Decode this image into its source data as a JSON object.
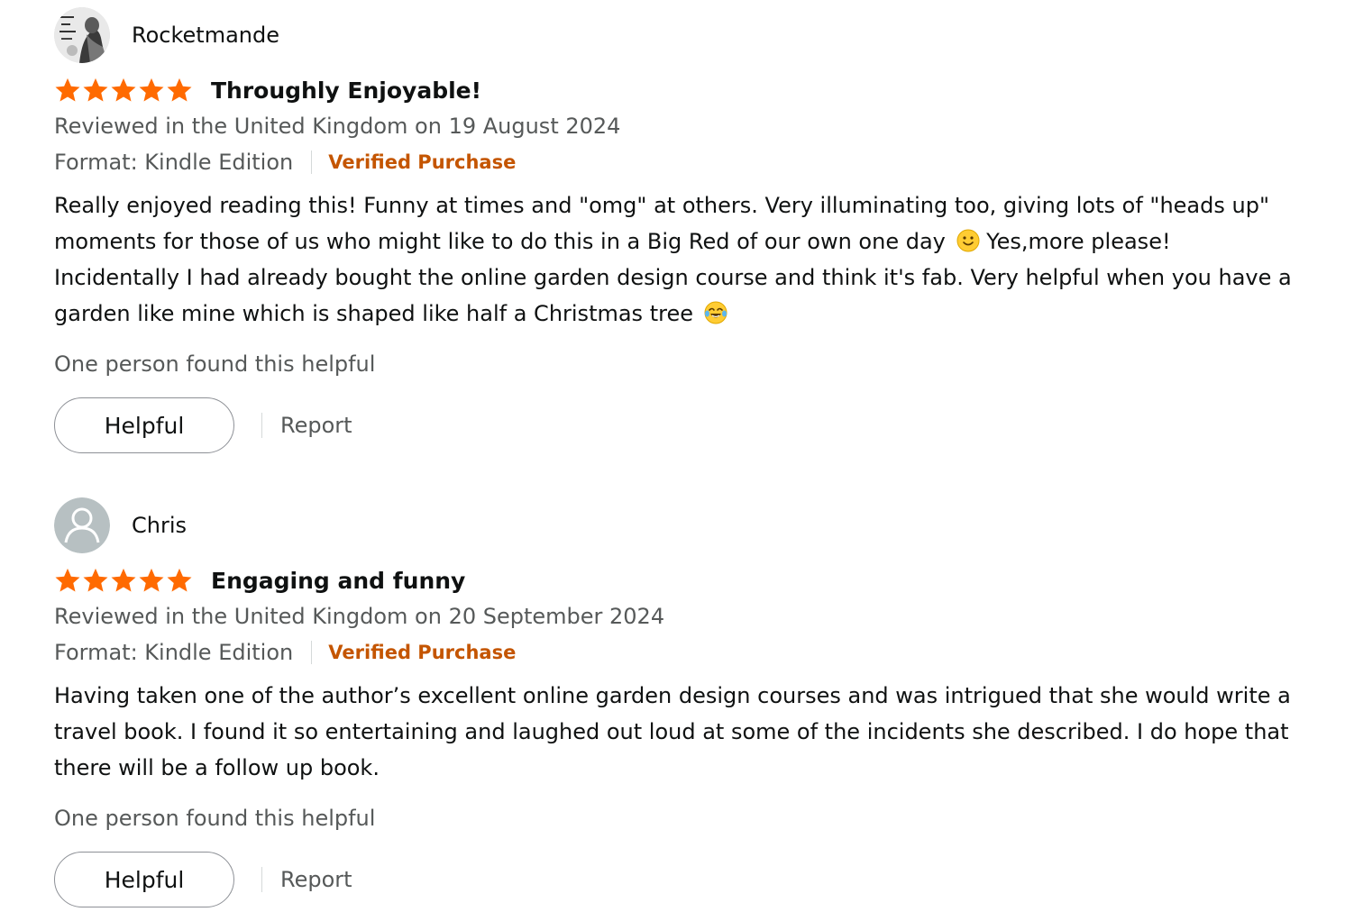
{
  "reviews": [
    {
      "profile_name": "Rocketmande",
      "avatar": "custom-photo-avatar",
      "rating": 5,
      "rating_max": 5,
      "title": "Throughly Enjoyable!",
      "date_text": "Reviewed in the United Kingdom on 19 August 2024",
      "format_text": "Format: Kindle Edition",
      "verified_label": "Verified Purchase",
      "body_parts": [
        "Really enjoyed reading this! Funny at times and \"omg\" at others. Very illuminating too, giving lots of \"heads up\" moments for those of us who might like to do this in a Big Red of our own one day",
        "Yes,more please! Incidentally I had already bought the online garden design course and think it's fab. Very helpful when you have a garden like mine which is shaped like half a Christmas tree"
      ],
      "emojis": [
        "slightly-smiling-face-emoji",
        "face-with-tears-of-joy-emoji"
      ],
      "helpful_count_text": "One person found this helpful",
      "helpful_label": "Helpful",
      "report_label": "Report"
    },
    {
      "profile_name": "Chris",
      "avatar": "default-person-avatar",
      "rating": 5,
      "rating_max": 5,
      "title": "Engaging and funny",
      "date_text": "Reviewed in the United Kingdom on 20 September 2024",
      "format_text": "Format: Kindle Edition",
      "verified_label": "Verified Purchase",
      "body": "Having taken one of the author’s excellent online garden design courses and was intrigued that she would write a travel book. I found it so entertaining and laughed out loud at some of the incidents she described. I do hope that there will be a follow up book.",
      "helpful_count_text": "One person found this helpful",
      "helpful_label": "Helpful",
      "report_label": "Report"
    }
  ],
  "colors": {
    "star": "#ff6a00",
    "verified": "#c45500",
    "secondary_text": "#565959",
    "primary_text": "#0f1111",
    "button_border": "#8d9096",
    "separator": "#d5d9d9"
  }
}
